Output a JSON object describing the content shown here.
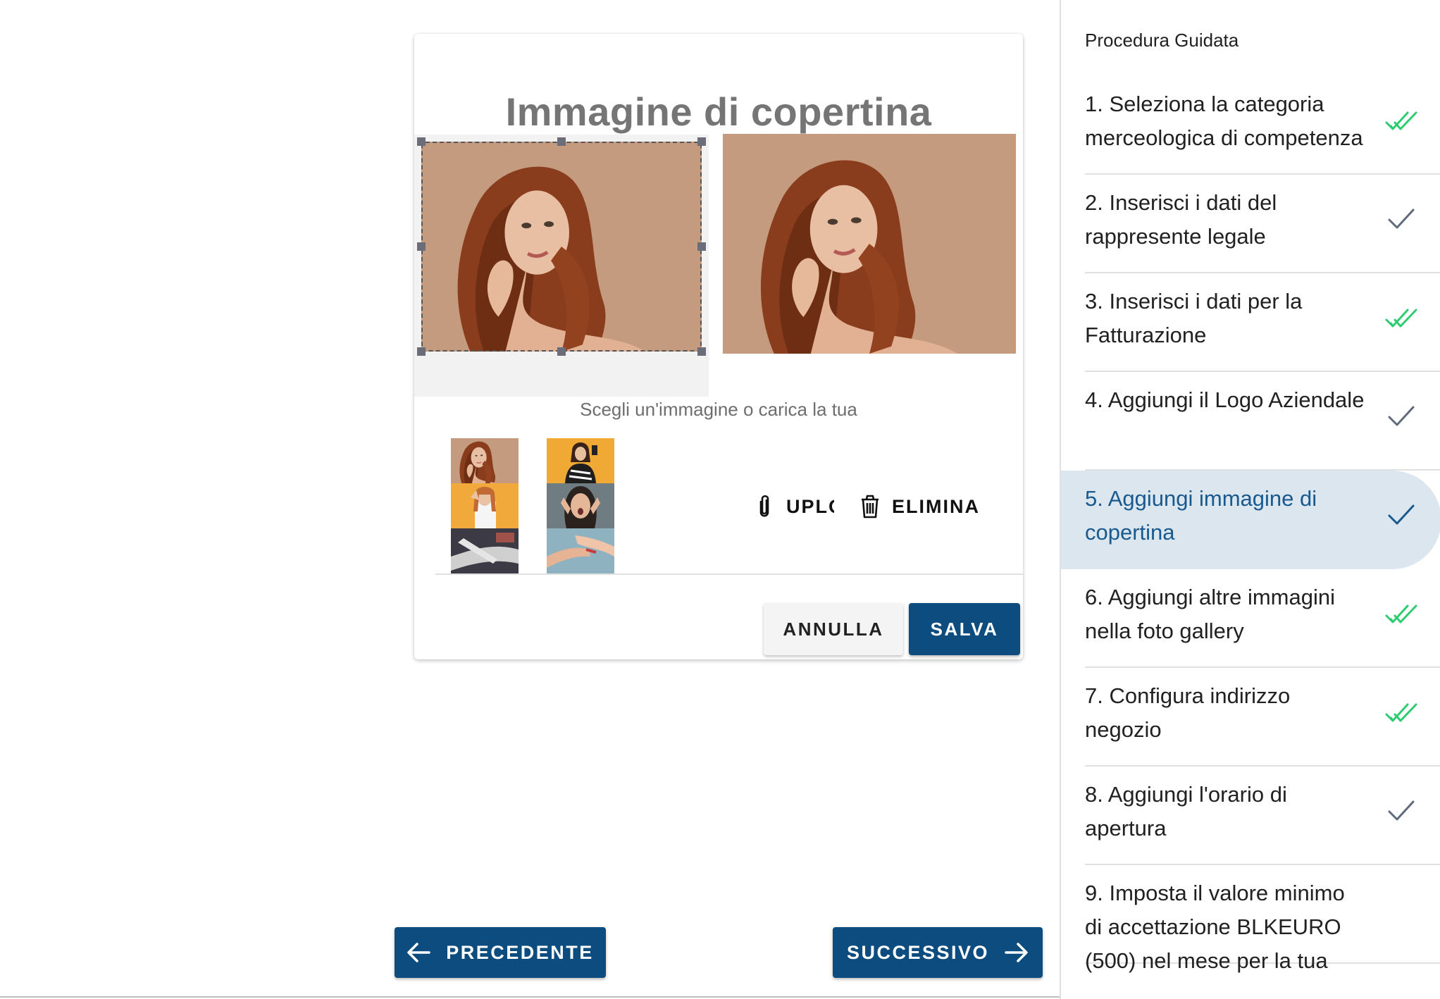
{
  "dialog": {
    "title": "Immagine di copertina",
    "choose_label": "Scegli un'immagine o carica la tua",
    "upload_label": "UPLOAD",
    "delete_label": "ELIMINA",
    "cancel_label": "ANNULLA",
    "save_label": "SALVA",
    "thumbnails": [
      "woman-beige-background",
      "woman-yellow-background",
      "woman-surprised-phone",
      "woman-surprised-hands",
      "hair-brushing",
      "hands-manicure"
    ]
  },
  "navigation": {
    "prev_label": "PRECEDENTE",
    "next_label": "SUCCESSIVO"
  },
  "sidebar": {
    "title": "Procedura Guidata",
    "steps": [
      {
        "label": "1. Seleziona la categoria merceologica di competenza",
        "check": "double-check-icon",
        "color": "#2ecc71"
      },
      {
        "label": "2. Inserisci i dati del rappresente legale",
        "check": "check-icon",
        "color": "#5f6b7a"
      },
      {
        "label": "3. Inserisci i dati per la Fatturazione",
        "check": "double-check-icon",
        "color": "#2ecc71"
      },
      {
        "label": "4. Aggiungi il Logo Aziendale",
        "check": "check-icon",
        "color": "#5f6b7a"
      },
      {
        "label": "5. Aggiungi immagine di copertina",
        "check": "check-icon",
        "color": "#185a8f",
        "active": true
      },
      {
        "label": "6. Aggiungi altre immagini nella foto gallery",
        "check": "double-check-icon",
        "color": "#2ecc71"
      },
      {
        "label": "7. Configura indirizzo negozio",
        "check": "double-check-icon",
        "color": "#2ecc71"
      },
      {
        "label": "8. Aggiungi l'orario di apertura",
        "check": "check-icon",
        "color": "#5f6b7a"
      },
      {
        "label": "9. Imposta il valore minimo di accettazione BLKEURO (500) nel mese per la tua"
      }
    ]
  }
}
